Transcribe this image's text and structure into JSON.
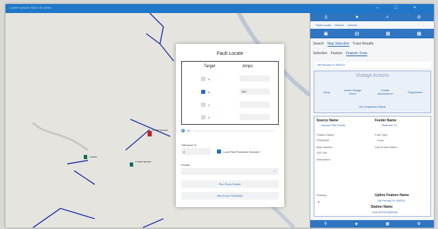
{
  "window": {
    "title": "Lorem ipsum dolor sit amet",
    "controls": [
      "–",
      "□",
      "×"
    ]
  },
  "map": {
    "labels": [
      "Lorem ipsum",
      "Lorem",
      "Lorem ipsum"
    ]
  },
  "dialog": {
    "title": "Fault Locate",
    "col_target": "Target",
    "col_amps": "Amps",
    "rows": [
      {
        "phase": "A",
        "checked": false,
        "amps": ""
      },
      {
        "phase": "B",
        "checked": true,
        "amps": "550"
      },
      {
        "phase": "C",
        "checked": false,
        "amps": ""
      },
      {
        "phase": "G",
        "checked": false,
        "amps": ""
      }
    ],
    "radio_selected_label": "1G",
    "tolerance_label": "Tolerance %",
    "tolerance_value": "2",
    "look_past_label": "Look Past Protective Devices?",
    "feeder_label": "Feeder",
    "run_from_feeder": "Run From Feeder",
    "run_from_point": "Run From P3254005"
  },
  "panel": {
    "top_icons": [
      "person-icon",
      "heart-icon",
      "check-icon",
      "block-icon"
    ],
    "links": [
      "Fault Locate",
      "Recent",
      "Actions"
    ],
    "tabs": [
      "Search",
      "Map Selection",
      "Trace Results"
    ],
    "subtabs": [
      "Selection",
      "Feature",
      "Feature: Fuse"
    ],
    "feature_line": "Off Primary PL 599741",
    "outage_title": "Outage Actions",
    "outage_buttons": [
      "Verify",
      "Active Outage Event",
      "Create Assessment",
      "Ping Meters"
    ],
    "set_temp": "Set Temporary Status",
    "source_name_label": "Source Name",
    "source_name_value": "Service Pole Points",
    "feeder_name_label": "Feeder Name",
    "feeder_name_value": "Redmont 73",
    "feature_name_label": "Feature Name",
    "feature_name_value": "P3254005",
    "fuse_type_label": "Fuse Type",
    "fuse_type_value": "Fuse",
    "map_number_label": "Map Number",
    "map_number_value": "10D-304",
    "last_name_label": "Last Known Name",
    "description_label": "Description",
    "phasing_label": "Phasing",
    "phasing_value": "B",
    "upline_label": "Upline Feature Name",
    "upline_value": "Off Primary PL 599741",
    "station_label": "Station Name",
    "station_value": "Pole 4PP2F3400046",
    "bottom_nav": [
      "Search",
      "Layers",
      "Tables",
      "Settings"
    ]
  },
  "colors": {
    "accent": "#2f75c1",
    "link": "#1b5fb0",
    "map_line": "#1a2fa8",
    "river": "#8aa3c4"
  }
}
